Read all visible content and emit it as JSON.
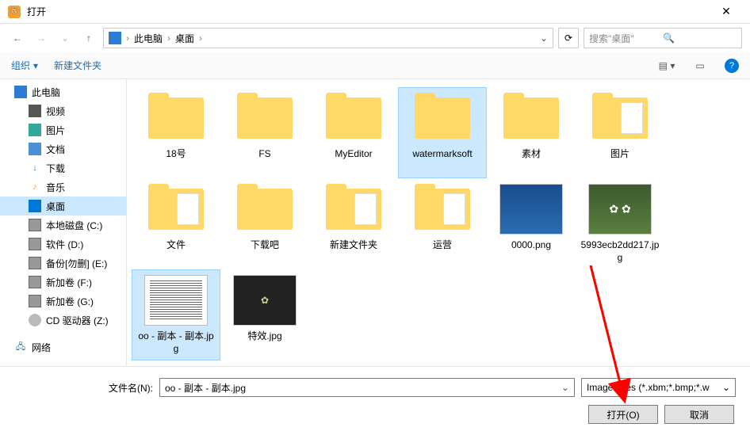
{
  "title": "打开",
  "breadcrumb": {
    "pc": "此电脑",
    "desk": "桌面"
  },
  "search_placeholder": "搜索\"桌面\"",
  "toolbar": {
    "organize": "组织",
    "newfolder": "新建文件夹"
  },
  "sidebar": {
    "pc": "此电脑",
    "children": [
      {
        "k": "vid",
        "l": "视频"
      },
      {
        "k": "pic",
        "l": "图片"
      },
      {
        "k": "doc",
        "l": "文档"
      },
      {
        "k": "dl",
        "l": "下载"
      },
      {
        "k": "mus",
        "l": "音乐"
      },
      {
        "k": "desk",
        "l": "桌面"
      },
      {
        "k": "c",
        "l": "本地磁盘 (C:)"
      },
      {
        "k": "d",
        "l": "软件 (D:)"
      },
      {
        "k": "e",
        "l": "备份[勿删] (E:)"
      },
      {
        "k": "f",
        "l": "新加卷 (F:)"
      },
      {
        "k": "g",
        "l": "新加卷 (G:)"
      },
      {
        "k": "z",
        "l": "CD 驱动器 (Z:)"
      }
    ],
    "network": "网络"
  },
  "items": [
    {
      "type": "folder",
      "label": "18号"
    },
    {
      "type": "folder",
      "label": "FS"
    },
    {
      "type": "folder",
      "label": "MyEditor"
    },
    {
      "type": "folder",
      "label": "watermarksoft",
      "hl": true
    },
    {
      "type": "folder",
      "label": "素材"
    },
    {
      "type": "folder-img",
      "label": "图片",
      "variant": "collage"
    },
    {
      "type": "folder-img",
      "label": "文件",
      "variant": "stamps"
    },
    {
      "type": "folder",
      "label": "下载吧"
    },
    {
      "type": "folder-img",
      "label": "新建文件夹",
      "variant": "colors"
    },
    {
      "type": "folder-img",
      "label": "运营",
      "variant": "gears"
    },
    {
      "type": "image",
      "label": "0000.png",
      "variant": "desktop"
    },
    {
      "type": "image",
      "label": "5993ecb2dd217.jpg",
      "variant": "flower"
    },
    {
      "type": "image",
      "label": "oo - 副本 - 副本.jpg",
      "variant": "doc",
      "hl": true
    },
    {
      "type": "image",
      "label": "特效.jpg",
      "variant": "dark"
    }
  ],
  "footer": {
    "fn_label": "文件名(N):",
    "fn_value": "oo - 副本 - 副本.jpg",
    "filter": "Image Files (*.xbm;*.bmp;*.w",
    "open": "打开(O)",
    "cancel": "取消"
  }
}
